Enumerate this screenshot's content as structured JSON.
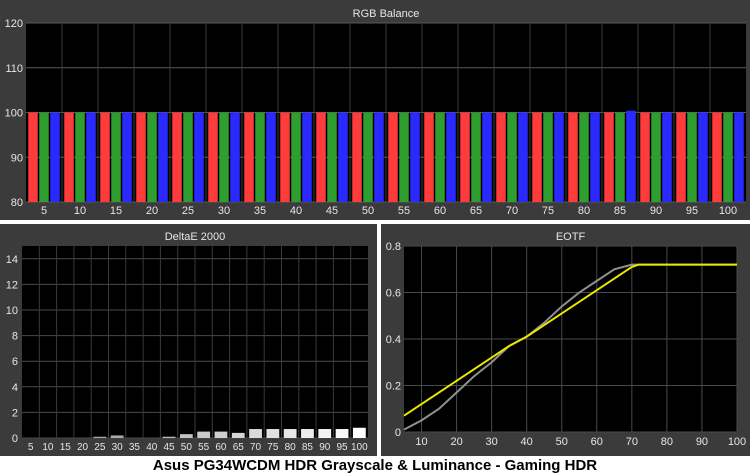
{
  "caption": "Asus PG34WCDM HDR Grayscale & Luminance - Gaming HDR",
  "chart_data": [
    {
      "type": "bar",
      "title": "RGB Balance",
      "categories": [
        "5",
        "10",
        "15",
        "20",
        "25",
        "30",
        "35",
        "40",
        "45",
        "50",
        "55",
        "60",
        "65",
        "70",
        "75",
        "80",
        "85",
        "90",
        "95",
        "100"
      ],
      "ylim": [
        80,
        120
      ],
      "yticks": [
        80,
        90,
        100,
        110,
        120
      ],
      "grid": true,
      "series": [
        {
          "name": "",
          "color": "#ff3b3b",
          "values": [
            100,
            100,
            100,
            100,
            100,
            100,
            100,
            100,
            100,
            100,
            100,
            100,
            100,
            100,
            100,
            100,
            100,
            100,
            100,
            100
          ]
        },
        {
          "name": "",
          "color": "#2e9e2e",
          "values": [
            100,
            100,
            100,
            100,
            100,
            100,
            100,
            100,
            100,
            100,
            100,
            100,
            100,
            100,
            100,
            100,
            100,
            100,
            100,
            100
          ]
        },
        {
          "name": "",
          "color": "#2a2aff",
          "values": [
            100,
            100,
            100,
            100,
            100,
            100,
            100,
            100,
            100,
            100,
            100,
            100,
            100,
            100,
            100,
            100,
            100.4,
            100,
            100,
            100
          ]
        }
      ]
    },
    {
      "type": "bar",
      "title": "DeltaE 2000",
      "categories": [
        "5",
        "10",
        "15",
        "20",
        "25",
        "30",
        "35",
        "40",
        "45",
        "50",
        "55",
        "60",
        "65",
        "70",
        "75",
        "80",
        "85",
        "90",
        "95",
        "100"
      ],
      "values": [
        0,
        0,
        0,
        0,
        0.1,
        0.2,
        0,
        0,
        0.1,
        0.3,
        0.5,
        0.5,
        0.4,
        0.7,
        0.7,
        0.7,
        0.7,
        0.7,
        0.7,
        0.8
      ],
      "ylim": [
        0,
        15
      ],
      "yticks": [
        0,
        2,
        4,
        6,
        8,
        10,
        12,
        14
      ],
      "grid": true
    },
    {
      "type": "line",
      "title": "EOTF",
      "xlim": [
        5,
        100
      ],
      "ylim": [
        0,
        0.8
      ],
      "xticks": [
        10,
        20,
        30,
        40,
        50,
        60,
        70,
        80,
        90,
        100
      ],
      "yticks": [
        0,
        0.2,
        0.4,
        0.6,
        0.8
      ],
      "grid": true,
      "series": [
        {
          "name": "",
          "color": "#909090",
          "x": [
            5,
            10,
            15,
            20,
            25,
            30,
            35,
            40,
            45,
            50,
            55,
            60,
            65,
            70,
            72,
            75,
            80,
            85,
            90,
            95,
            100
          ],
          "y": [
            0.01,
            0.05,
            0.1,
            0.17,
            0.24,
            0.3,
            0.37,
            0.41,
            0.47,
            0.54,
            0.6,
            0.65,
            0.7,
            0.72,
            0.72,
            0.72,
            0.72,
            0.72,
            0.72,
            0.72,
            0.72
          ]
        },
        {
          "name": "",
          "color": "#e8e800",
          "x": [
            5,
            10,
            15,
            20,
            25,
            30,
            35,
            40,
            45,
            50,
            55,
            60,
            65,
            70,
            72,
            75,
            80,
            85,
            90,
            95,
            100
          ],
          "y": [
            0.07,
            0.12,
            0.17,
            0.22,
            0.27,
            0.32,
            0.37,
            0.41,
            0.46,
            0.51,
            0.56,
            0.61,
            0.66,
            0.71,
            0.72,
            0.72,
            0.72,
            0.72,
            0.72,
            0.72,
            0.72
          ]
        }
      ]
    }
  ]
}
